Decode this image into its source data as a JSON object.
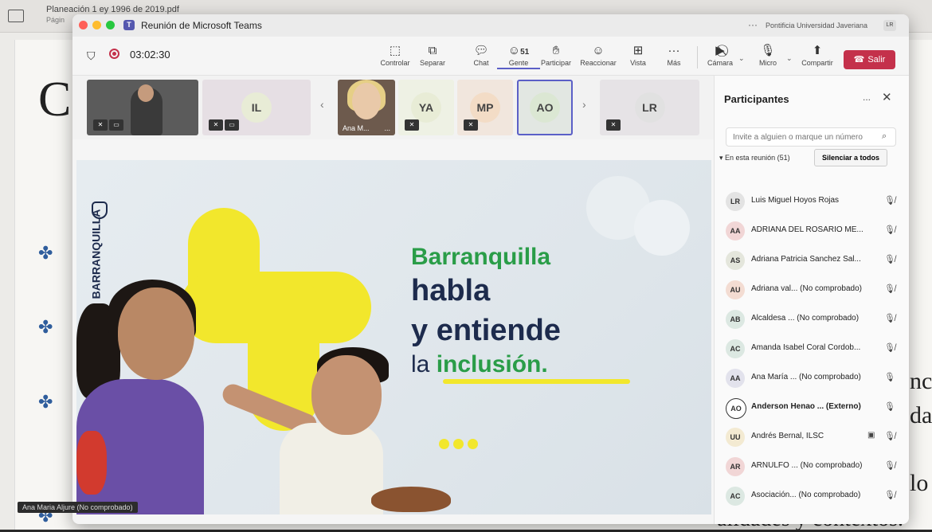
{
  "document": {
    "title": "Planeación 1 ey 1996 de 2019.pdf",
    "subtitle": "Págin",
    "big_letter": "C",
    "right_text": [
      "nc",
      "da",
      "lo"
    ],
    "bottom_text": "alidades y contextos."
  },
  "window": {
    "title": "Reunión de Microsoft Teams",
    "organization": "Pontificia Universidad Javeriana",
    "account_initials": "LR",
    "traffic_lights": {
      "close": "#ff5f57",
      "minimize": "#febc2e",
      "zoom": "#28c840"
    }
  },
  "toolbar": {
    "timer": "03:02:30",
    "buttons": [
      {
        "id": "controlar",
        "label": "Controlar",
        "icon": "control-icon"
      },
      {
        "id": "separar",
        "label": "Separar",
        "icon": "popout-icon"
      },
      {
        "id": "chat",
        "label": "Chat",
        "icon": "chat-icon"
      },
      {
        "id": "gente",
        "label": "Gente",
        "icon": "people-icon",
        "count": "51"
      },
      {
        "id": "participar",
        "label": "Participar",
        "icon": "raise-hand-icon"
      },
      {
        "id": "reaccionar",
        "label": "Reaccionar",
        "icon": "smiley-icon"
      },
      {
        "id": "vista",
        "label": "Vista",
        "icon": "grid-icon"
      },
      {
        "id": "mas",
        "label": "Más",
        "icon": "more-icon"
      },
      {
        "id": "camara",
        "label": "Cámara",
        "icon": "camera-off-icon"
      },
      {
        "id": "micro",
        "label": "Micro",
        "icon": "mic-off-icon"
      },
      {
        "id": "compartir",
        "label": "Compartir",
        "icon": "share-icon"
      }
    ],
    "leave_label": "Salir",
    "accent": "#5b5fc7",
    "leave_color": "#c4314b"
  },
  "thumbnails": {
    "tiles": [
      "IL",
      "YA",
      "MP",
      "AO",
      "LR"
    ],
    "video_name": "Ana M...",
    "more": "..."
  },
  "shared_content": {
    "brand": "BARRANQUILLA",
    "line1": "Barranquilla",
    "line2": "habla",
    "line3": "y entiende",
    "line4_prefix": "la",
    "line4_highlight": "inclusión.",
    "green": "#2a9d48",
    "navy": "#1d2b4d",
    "yellow": "#f2e72c"
  },
  "caption": "Ana Maria Aljure (No comprobado)",
  "participants": {
    "title": "Participantes",
    "more": "...",
    "search_placeholder": "Invite a alguien o marque un número",
    "section_label": "En esta reunión (51)",
    "mute_all_label": "Silenciar a todos",
    "list": [
      {
        "initials": "LR",
        "name": "Luis Miguel Hoyos Rojas",
        "color": "#e3e3e3",
        "mic": "muted"
      },
      {
        "initials": "AA",
        "name": "ADRIANA DEL ROSARIO ME...",
        "color": "#f1d6d6",
        "mic": "muted"
      },
      {
        "initials": "AS",
        "name": "Adriana Patricia Sanchez Sal...",
        "color": "#e4e6dc",
        "mic": "muted"
      },
      {
        "initials": "AU",
        "name": "Adriana val... (No comprobado)",
        "color": "#f3dcd2",
        "mic": "muted"
      },
      {
        "initials": "AB",
        "name": "Alcaldesa ... (No comprobado)",
        "color": "#dce8e2",
        "mic": "muted"
      },
      {
        "initials": "AC",
        "name": "Amanda Isabel Coral Cordob...",
        "color": "#dce8e2",
        "mic": "muted"
      },
      {
        "initials": "AA",
        "name": "Ana María ... (No comprobado)",
        "color": "#e2e2ec",
        "mic": "on"
      },
      {
        "initials": "AO",
        "name": "Anderson Henao ... (Externo)",
        "color": "#ffffff",
        "mic": "on"
      },
      {
        "initials": "UU",
        "name": "Andrés Bernal, ILSC",
        "color": "#f3ead2",
        "mic": "muted"
      },
      {
        "initials": "AR",
        "name": "ARNULFO ... (No comprobado)",
        "color": "#f1d6d6",
        "mic": "muted"
      },
      {
        "initials": "AC",
        "name": "Asociación... (No comprobado)",
        "color": "#dce8e2",
        "mic": "muted"
      }
    ]
  }
}
